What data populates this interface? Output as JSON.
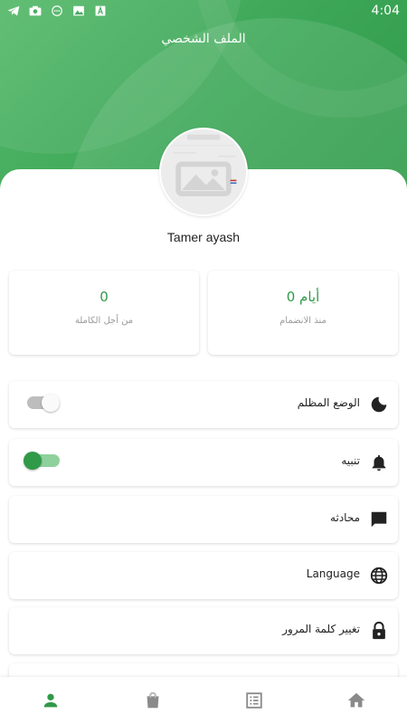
{
  "status_bar": {
    "time": "4:04",
    "icons": [
      "telegram-icon",
      "camera-icon",
      "sms-icon",
      "image-icon",
      "a-icon"
    ]
  },
  "header": {
    "title": "الملف الشخصي"
  },
  "profile": {
    "name": "Tamer ayash"
  },
  "stats": {
    "days": {
      "value": "0 أيام",
      "label": "منذ الانضمام"
    },
    "complete": {
      "value": "0",
      "label": "من أجل الكاملة"
    }
  },
  "settings": {
    "dark_mode": {
      "label": "الوضع المظلم",
      "enabled": false
    },
    "notifications": {
      "label": "تنبيه",
      "enabled": true
    },
    "chat": {
      "label": "محادثه"
    },
    "language": {
      "label": "Language"
    },
    "change_password": {
      "label": "تغيير كلمة المرور"
    }
  },
  "bottom_nav": [
    "profile",
    "bag",
    "list",
    "home"
  ],
  "colors": {
    "accent": "#2f9a48",
    "header_green": "#3ba656",
    "toggle_on_track": "#8fd19d",
    "toggle_off_track": "#bdbdbd",
    "nav_inactive": "#8a8a8a"
  }
}
